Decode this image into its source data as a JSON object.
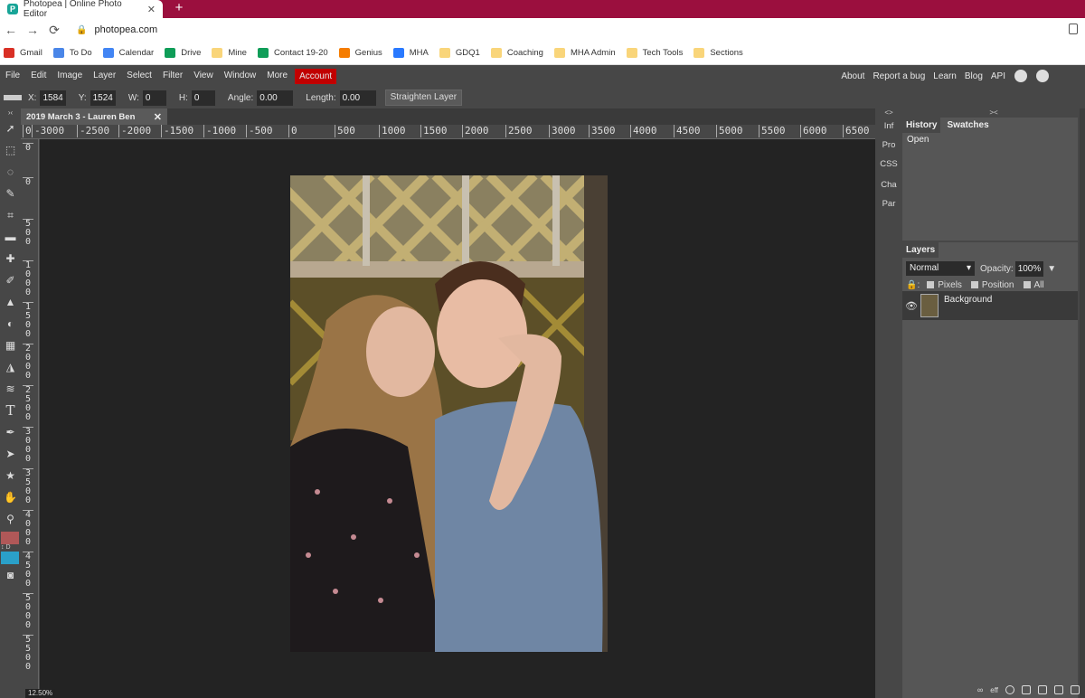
{
  "browser": {
    "tab_title": "Photopea | Online Photo Editor",
    "tab_close": "✕",
    "new_tab": "+",
    "url": "photopea.com",
    "bookmarks": [
      {
        "label": "Gmail",
        "color": "#d93025"
      },
      {
        "label": "To Do",
        "color": "#4a86e8"
      },
      {
        "label": "Calendar",
        "color": "#4285f4"
      },
      {
        "label": "Drive",
        "color": "#0f9d58"
      },
      {
        "label": "Mine",
        "color": "#f9d57a"
      },
      {
        "label": "Contact 19-20",
        "color": "#0f9d58"
      },
      {
        "label": "Genius",
        "color": "#f57c00"
      },
      {
        "label": "MHA",
        "color": "#2979ff"
      },
      {
        "label": "GDQ1",
        "color": "#f9d57a"
      },
      {
        "label": "Coaching",
        "color": "#f9d57a"
      },
      {
        "label": "MHA Admin",
        "color": "#f9d57a"
      },
      {
        "label": "Tech Tools",
        "color": "#f9d57a"
      },
      {
        "label": "Sections",
        "color": "#f9d57a"
      }
    ]
  },
  "menu": {
    "items": [
      "File",
      "Edit",
      "Image",
      "Layer",
      "Select",
      "Filter",
      "View",
      "Window",
      "More"
    ],
    "account": "Account",
    "right_links": [
      "About",
      "Report a bug",
      "Learn",
      "Blog",
      "API"
    ]
  },
  "options": {
    "x_label": "X:",
    "x_value": "1584",
    "y_label": "Y:",
    "y_value": "1524",
    "w_label": "W:",
    "w_value": "0",
    "h_label": "H:",
    "h_value": "0",
    "angle_label": "Angle:",
    "angle_value": "0.00",
    "length_label": "Length:",
    "length_value": "0.00",
    "straighten": "Straighten Layer"
  },
  "document": {
    "tab_title": "2019 March 3 - Lauren Ben",
    "tab_close": "✕",
    "zoom": "12.50%"
  },
  "hruler_ticks": [
    "0",
    "-3000",
    "-2500",
    "-2000",
    "-1500",
    "-1000",
    "-500",
    "0",
    "500",
    "1000",
    "1500",
    "2000",
    "2500",
    "3000",
    "3500",
    "4000",
    "4500",
    "5000",
    "5500",
    "6000",
    "6500"
  ],
  "vruler_ticks": [
    "0",
    "0",
    "500",
    "1000",
    "1500",
    "2000",
    "2500",
    "3000",
    "3500",
    "4000",
    "4500",
    "5000",
    "5500"
  ],
  "mini_panel": {
    "collapse": "<>",
    "items": [
      "Inf",
      "Pro",
      "CSS",
      "Cha",
      "Par"
    ]
  },
  "history": {
    "collapse": "><",
    "tab_history": "History",
    "tab_swatches": "Swatches",
    "entries": [
      "Open"
    ]
  },
  "layers": {
    "tab": "Layers",
    "blend_mode": "Normal",
    "opacity_label": "Opacity:",
    "opacity_value": "100%",
    "lock_pixels": "Pixels",
    "lock_position": "Position",
    "lock_all": "All",
    "layer_name": "Background",
    "bottom_fx": "eff"
  },
  "colors": {
    "foreground": "#b05858",
    "background": "#2aa0c8",
    "accent": "#c10000",
    "tabstrip": "#9b0f3e"
  }
}
